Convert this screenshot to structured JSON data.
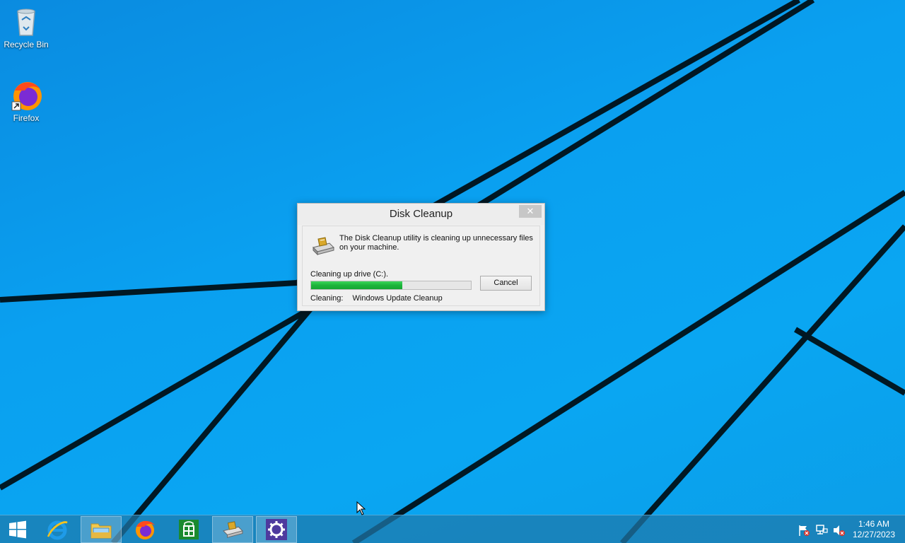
{
  "desktop": {
    "icons": [
      {
        "label": "Recycle Bin"
      },
      {
        "label": "Firefox"
      }
    ]
  },
  "dialog": {
    "title": "Disk Cleanup",
    "close_glyph": "✕",
    "description": "The Disk Cleanup utility is cleaning up unnecessary files on your machine.",
    "progress_label": "Cleaning up drive  (C:).",
    "progress_fraction": 0.57,
    "cancel_label": "Cancel",
    "cleaning_label": "Cleaning:",
    "cleaning_item": "Windows Update Cleanup"
  },
  "taskbar": {
    "buttons": [
      {
        "icon": "windows-start-icon"
      },
      {
        "icon": "internet-explorer-icon"
      },
      {
        "icon": "file-explorer-icon",
        "active": true
      },
      {
        "icon": "firefox-icon"
      },
      {
        "icon": "store-icon"
      },
      {
        "icon": "disk-cleanup-icon",
        "active": true
      },
      {
        "icon": "settings-gear-icon",
        "active": true
      }
    ],
    "tray": [
      "action-center-flag-icon",
      "network-icon",
      "volume-muted-icon"
    ],
    "clock": {
      "time": "1:46 AM",
      "date": "12/27/2023"
    }
  },
  "colors": {
    "wallpaper": "#0aa0f0",
    "progress": "#1db43b",
    "store": "#1b8a2f",
    "settings": "#4e3a9e"
  }
}
